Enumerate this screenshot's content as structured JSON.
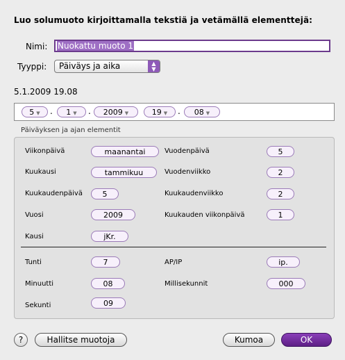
{
  "dialog": {
    "title": "Luo solumuoto kirjoittamalla tekstiä ja vetämällä elementtejä:",
    "name_label": "Nimi:",
    "name_value": "Nuokattu muoto 1",
    "type_label": "Tyyppi:",
    "type_value": "Päiväys ja aika",
    "preview": "5.1.2009 19.08"
  },
  "format_tokens": [
    {
      "value": "5",
      "sep": "."
    },
    {
      "value": "1",
      "sep": "."
    },
    {
      "value": "2009",
      "sep": ""
    },
    {
      "value": "19",
      "sep": "."
    },
    {
      "value": "08",
      "sep": ""
    }
  ],
  "elements": {
    "group_title": "Päiväyksen ja ajan elementit",
    "weekday_label": "Viikonpäivä",
    "weekday_value": "maanantai",
    "dayofyear_label": "Vuodenpäivä",
    "dayofyear_value": "5",
    "month_label": "Kuukausi",
    "month_value": "tammikuu",
    "weekofyear_label": "Vuodenviikko",
    "weekofyear_value": "2",
    "dayofmonth_label": "Kuukaudenpäivä",
    "dayofmonth_value": "5",
    "weekofmonth_label": "Kuukaudenviikko",
    "weekofmonth_value": "2",
    "year_label": "Vuosi",
    "year_value": "2009",
    "weekdayofmonth_label": "Kuukauden viikonpäivä",
    "weekdayofmonth_value": "1",
    "era_label": "Kausi",
    "era_value": "jKr.",
    "hour_label": "Tunti",
    "hour_value": "7",
    "ampm_label": "AP/IP",
    "ampm_value": "ip.",
    "minute_label": "Minuutti",
    "minute_value": "08",
    "ms_label": "Millisekunnit",
    "ms_value": "000",
    "second_label": "Sekunti",
    "second_value": "09"
  },
  "footer": {
    "help": "?",
    "manage": "Hallitse muotoja",
    "cancel": "Kumoa",
    "ok": "OK"
  }
}
